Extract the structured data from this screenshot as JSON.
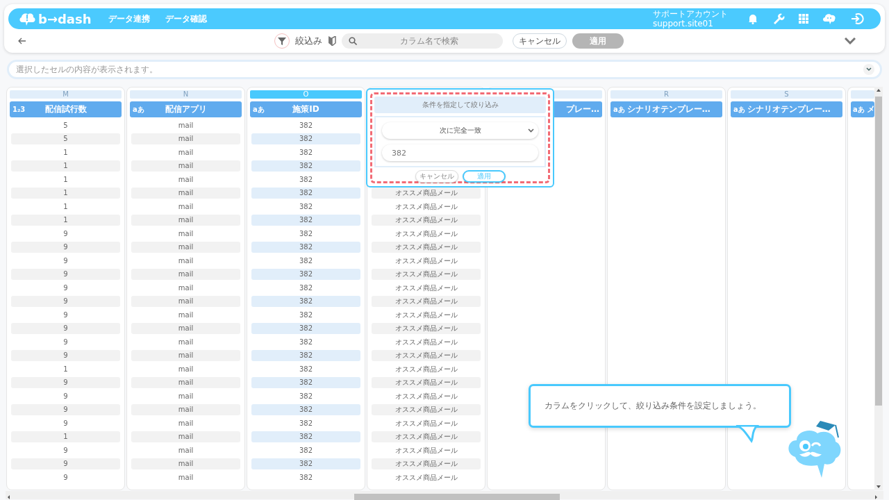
{
  "header": {
    "logo": "b→dash",
    "nav": [
      {
        "label": "データ連携"
      },
      {
        "label": "データ確認"
      }
    ],
    "account": {
      "name": "サポートアカウント",
      "id": "support.site01"
    }
  },
  "toolbar": {
    "filter_label": "絞込み",
    "search": {
      "placeholder": "カラム名で検索"
    },
    "cancel": "キャンセル",
    "apply": {
      "label": "適用",
      "disabled": true
    }
  },
  "cell_viewer": {
    "placeholder": "選択したセルの内容が表示されます。"
  },
  "columns": [
    {
      "letter": "M",
      "title": "配信試行数",
      "type_badge": "1₂3",
      "selected": false,
      "cells": [
        "5",
        "5",
        "1",
        "1",
        "1",
        "1",
        "1",
        "1",
        "9",
        "9",
        "9",
        "9",
        "9",
        "9",
        "9",
        "9",
        "9",
        "9",
        "1",
        "9",
        "9",
        "9",
        "9",
        "1",
        "9",
        "9",
        "9"
      ]
    },
    {
      "letter": "N",
      "title": "配信アプリ",
      "type_badge": "aあ",
      "selected": false,
      "cells": [
        "mail",
        "mail",
        "mail",
        "mail",
        "mail",
        "mail",
        "mail",
        "mail",
        "mail",
        "mail",
        "mail",
        "mail",
        "mail",
        "mail",
        "mail",
        "mail",
        "mail",
        "mail",
        "mail",
        "mail",
        "mail",
        "mail",
        "mail",
        "mail",
        "mail",
        "mail",
        "mail"
      ]
    },
    {
      "letter": "O",
      "title": "施策ID",
      "type_badge": "aあ",
      "selected": true,
      "cells": [
        "382",
        "382",
        "382",
        "382",
        "382",
        "382",
        "382",
        "382",
        "382",
        "382",
        "382",
        "382",
        "382",
        "382",
        "382",
        "382",
        "382",
        "382",
        "382",
        "382",
        "382",
        "382",
        "382",
        "382",
        "382",
        "382",
        "382"
      ]
    },
    {
      "cells": [
        "オススメ商品メール",
        "オススメ商品メール",
        "オススメ商品メール",
        "オススメ商品メール",
        "オススメ商品メール",
        "オススメ商品メール",
        "オススメ商品メール",
        "オススメ商品メール",
        "オススメ商品メール",
        "オススメ商品メール",
        "オススメ商品メール",
        "オススメ商品メール",
        "オススメ商品メール",
        "オススメ商品メール",
        "オススメ商品メール",
        "オススメ商品メール",
        "オススメ商品メール",
        "オススメ商品メール",
        "オススメ商品メール",
        "オススメ商品メール",
        "オススメ商品メール",
        "オススメ商品メール"
      ]
    },
    {
      "title": "プレー…",
      "title_clipped": true
    },
    {
      "letter": "R",
      "title": "シナリオテンプレー…",
      "type_badge": "aあ",
      "selected": false
    },
    {
      "letter": "S",
      "title": "シナリオテンプレー…",
      "type_badge": "aあ",
      "selected": false
    },
    {
      "title": "メ",
      "type_badge": "aあ",
      "kind": "partial",
      "selected": false
    }
  ],
  "filter_popover": {
    "title": "条件を指定して絞り込み",
    "condition": "次に完全一致",
    "value": "382",
    "cancel": "キャンセル",
    "apply": "適用"
  },
  "hint": {
    "text": "カラムをクリックして、絞り込み条件を設定しましょう。"
  }
}
